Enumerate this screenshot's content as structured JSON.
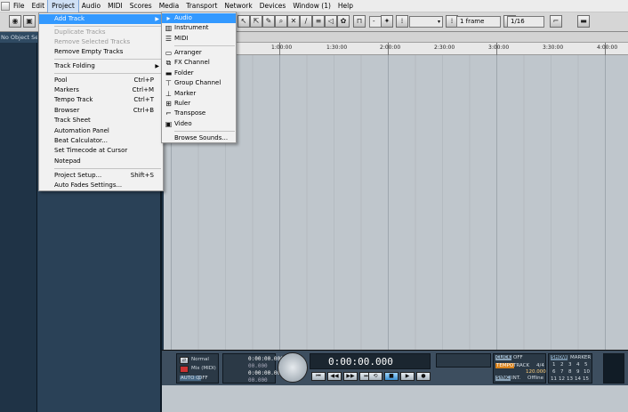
{
  "menubar": {
    "items": [
      "File",
      "Edit",
      "Project",
      "Audio",
      "MIDI",
      "Scores",
      "Media",
      "Transport",
      "Network",
      "Devices",
      "Window (1)",
      "Help"
    ]
  },
  "toolbar": {
    "grid_type": "1 frame",
    "quantize": "1/16",
    "dash_field": "-"
  },
  "inspector": {
    "title": "No Object Selected"
  },
  "ruler": {
    "ticks": [
      "1:00:00",
      "1:30:00",
      "2:00:00",
      "2:30:00",
      "3:00:00",
      "3:30:00",
      "4:00:00"
    ]
  },
  "project_menu": {
    "add_track": "Add Track",
    "duplicate_tracks": "Duplicate Tracks",
    "remove_selected_tracks": "Remove Selected Tracks",
    "remove_empty_tracks": "Remove Empty Tracks",
    "track_folding": "Track Folding",
    "pool": "Pool",
    "pool_sc": "Ctrl+P",
    "markers": "Markers",
    "markers_sc": "Ctrl+M",
    "tempo_track": "Tempo Track",
    "tempo_track_sc": "Ctrl+T",
    "browser": "Browser",
    "browser_sc": "Ctrl+B",
    "track_sheet": "Track Sheet",
    "automation_panel": "Automation Panel",
    "beat_calculator": "Beat Calculator...",
    "set_timecode": "Set Timecode at Cursor",
    "notepad": "Notepad",
    "project_setup": "Project Setup...",
    "project_setup_sc": "Shift+S",
    "auto_fades": "Auto Fades Settings..."
  },
  "add_track_menu": {
    "audio": "Audio",
    "instrument": "Instrument",
    "midi": "MIDI",
    "arranger": "Arranger",
    "fx_channel": "FX Channel",
    "folder": "Folder",
    "group_channel": "Group Channel",
    "marker": "Marker",
    "ruler": "Ruler",
    "transpose": "Transpose",
    "video": "Video",
    "browse_sounds": "Browse Sounds..."
  },
  "transport": {
    "mode_normal": "Normal",
    "mode_mix": "Mix (MIDI)",
    "auto_q": "AUTO Q",
    "auto_q_state": "OFF",
    "left_locator": "0:00:00.000",
    "left_small": "00.000",
    "right_locator": "0:00:00.000",
    "right_small": "00.000",
    "main_time": "0:00:00.000",
    "click": "CLICK",
    "click_state": "OFF",
    "tempo": "TEMPO",
    "track_label": "TRACK",
    "signature": "4/4",
    "bpm": "120.000",
    "sync": "SYNC",
    "sync_int": "INT.",
    "sync_offline": "Offline",
    "show": "SHOW",
    "marker": "MARKER",
    "marker_numbers": [
      "1",
      "2",
      "3",
      "4",
      "5",
      "6",
      "7",
      "8",
      "9",
      "10",
      "11",
      "12",
      "13",
      "14",
      "15"
    ]
  },
  "colors": {
    "highlight": "#3399ff",
    "accent_orange": "#d9821c",
    "inspector_bg": "#1f3346",
    "arrange_bg": "#bfc6cc"
  }
}
